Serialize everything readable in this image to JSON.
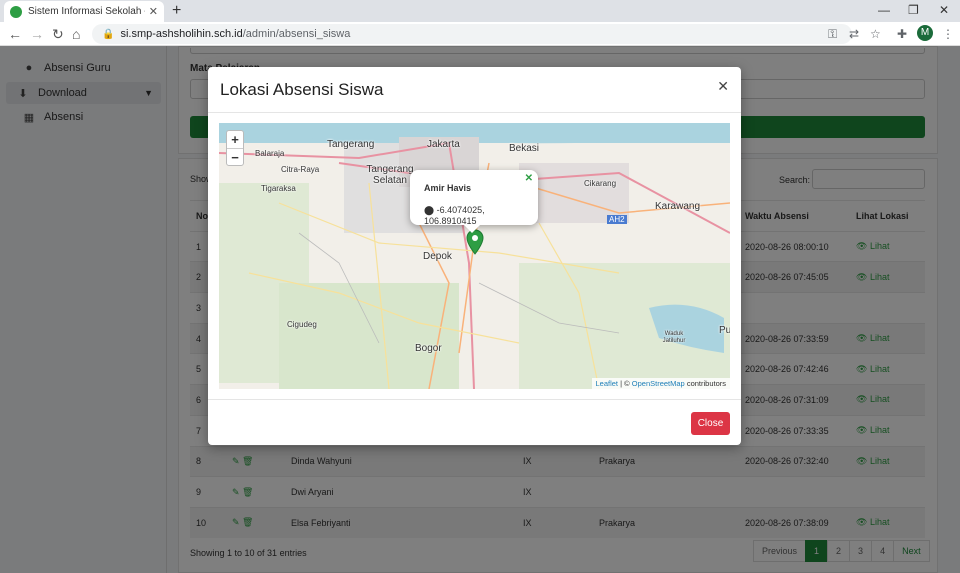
{
  "browser": {
    "tab_title": "Sistem Informasi Sekolah - Absensi",
    "url_host": "si.smp-ashsholihin.sch.id",
    "url_path": "/admin/absensi_siswa",
    "profile_initial": "M"
  },
  "sidebar": {
    "items": [
      {
        "label": "Absensi Guru",
        "icon": "check-circle-icon"
      },
      {
        "label": "Download",
        "icon": "download-icon"
      },
      {
        "label": "Absensi",
        "icon": "calendar-icon"
      }
    ]
  },
  "filter": {
    "mata_pelajaran_label": "Mata Pelajaran"
  },
  "table": {
    "show_label": "Show",
    "search_label": "Search:",
    "headers": [
      "No",
      "",
      "",
      "",
      "",
      "Waktu Absensi",
      "Lihat Lokasi"
    ],
    "rows": [
      {
        "no": "1",
        "nama": "",
        "kelas": "",
        "mapel": "",
        "waktu": "2020-08-26 08:00:10",
        "lihat": "Lihat"
      },
      {
        "no": "2",
        "nama": "",
        "kelas": "",
        "mapel": "",
        "waktu": "2020-08-26 07:45:05",
        "lihat": "Lihat"
      },
      {
        "no": "3",
        "nama": "",
        "kelas": "",
        "mapel": "",
        "waktu": "",
        "lihat": ""
      },
      {
        "no": "4",
        "nama": "",
        "kelas": "",
        "mapel": "",
        "waktu": "2020-08-26 07:33:59",
        "lihat": "Lihat"
      },
      {
        "no": "5",
        "nama": "",
        "kelas": "",
        "mapel": "",
        "waktu": "2020-08-26 07:42:46",
        "lihat": "Lihat"
      },
      {
        "no": "6",
        "nama": "",
        "kelas": "",
        "mapel": "",
        "waktu": "2020-08-26 07:31:09",
        "lihat": "Lihat"
      },
      {
        "no": "7",
        "nama": "",
        "kelas": "",
        "mapel": "",
        "waktu": "2020-08-26 07:33:35",
        "lihat": "Lihat"
      },
      {
        "no": "8",
        "nama": "Dinda Wahyuni",
        "kelas": "IX",
        "mapel": "Prakarya",
        "waktu": "2020-08-26 07:32:40",
        "lihat": "Lihat"
      },
      {
        "no": "9",
        "nama": "Dwi Aryani",
        "kelas": "IX",
        "mapel": "",
        "waktu": "",
        "lihat": ""
      },
      {
        "no": "10",
        "nama": "Elsa Febriyanti",
        "kelas": "IX",
        "mapel": "Prakarya",
        "waktu": "2020-08-26 07:38:09",
        "lihat": "Lihat"
      }
    ],
    "info": "Showing 1 to 10 of 31 entries",
    "pager": {
      "previous": "Previous",
      "pages": [
        "1",
        "2",
        "3",
        "4"
      ],
      "next": "Next"
    }
  },
  "modal": {
    "title": "Lokasi Absensi Siswa",
    "close_label": "Close",
    "popup_name": "Amir Havis",
    "popup_coord": "-6.4074025, 106.8910415",
    "attribution_leaflet": "Leaflet",
    "attribution_osm": "OpenStreetMap",
    "attribution_suffix": "contributors",
    "places": [
      "Tangerang",
      "Jakarta",
      "Bekasi",
      "Balaraja",
      "Citra-Raya",
      "Tigaraksa",
      "Tangerang Selatan",
      "Cikarang",
      "Karawang",
      "AH2",
      "Depok",
      "Cigudeg",
      "Bogor",
      "Waduk Jatiluhur",
      "Pu"
    ]
  },
  "colors": {
    "accent": "#1e8a3a",
    "danger": "#dc3545",
    "marker": "#2e9e44"
  }
}
